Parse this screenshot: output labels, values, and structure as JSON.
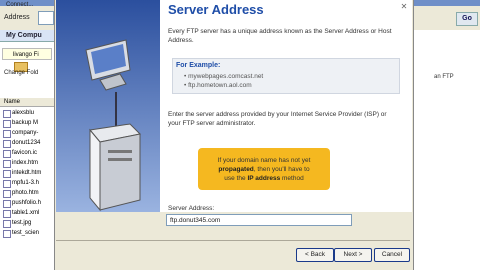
{
  "browser": {
    "connect_text": "Connect...",
    "address_label": "Address",
    "go_label": "Go",
    "right_ftp_text": "an FTP"
  },
  "left_pane": {
    "tab_label": "My Compu",
    "folder_label": "livango Fi",
    "change_folder_label": "Change Fold",
    "name_header": "Name",
    "files": [
      "alexsblu",
      "backup M",
      "company-",
      "donut1234",
      "favicon.ic",
      "index.htm",
      "intekdt.htm",
      "mpfu1-3.h",
      "photo.htm",
      "pushfolio.h",
      "table1.xml",
      "test.jpg",
      "test_scien"
    ]
  },
  "wizard": {
    "title": "Server Address",
    "intro_text": "Every FTP server has a unique address known as the Server Address or Host Address.",
    "example_label": "For Example:",
    "examples": [
      "mywebpages.comcast.net",
      "ftp.hometown.aol.com"
    ],
    "instruction_text": "Enter the server address provided by your Internet Service Provider (ISP) or your FTP server administrator.",
    "callout": {
      "line1": "If your domain name has not yet",
      "bold1": "propagated",
      "line2": ", then you'll have to",
      "line3_pre": "use the ",
      "bold2": "IP address",
      "line3_post": " method"
    },
    "server_address_label": "Server Address:",
    "server_address_value": "ftp.donut345.com",
    "buttons": {
      "back": "< Back",
      "next": "Next >",
      "cancel": "Cancel"
    }
  }
}
